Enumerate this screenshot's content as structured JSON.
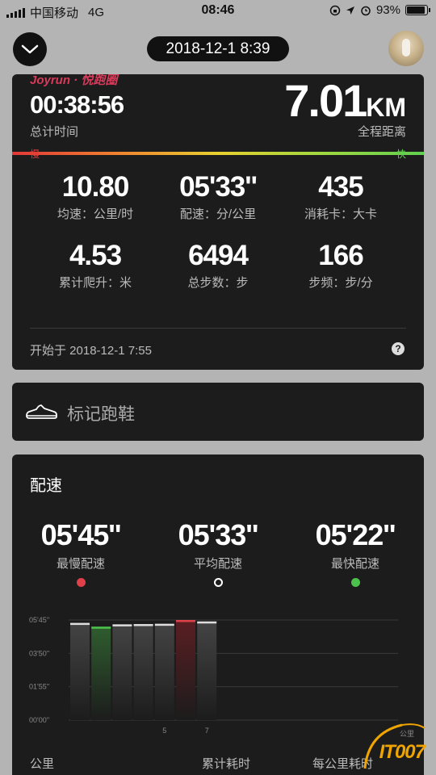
{
  "status_bar": {
    "carrier": "中国移动",
    "network": "4G",
    "time": "08:46",
    "battery": "93%"
  },
  "header": {
    "date": "2018-12-1 8:39"
  },
  "summary": {
    "brand": "Joyrun · 悦跑圈",
    "duration": "00:38:56",
    "duration_label": "总计时间",
    "distance": "7.01",
    "distance_unit": "KM",
    "distance_label": "全程距离",
    "slow_label": "慢",
    "fast_label": "快",
    "stats": [
      {
        "value": "10.80",
        "label": "均速：公里/时"
      },
      {
        "value": "05'33''",
        "label": "配速：分/公里"
      },
      {
        "value": "435",
        "label": "消耗卡：大卡"
      },
      {
        "value": "4.53",
        "label": "累计爬升：米"
      },
      {
        "value": "6494",
        "label": "总步数：步"
      },
      {
        "value": "166",
        "label": "步频：步/分"
      }
    ],
    "start_time": "开始于 2018-12-1 7:55",
    "help": "?"
  },
  "shoe": {
    "label": "标记跑鞋"
  },
  "pace": {
    "title": "配速",
    "slowest": {
      "value": "05'45''",
      "label": "最慢配速",
      "color": "#e0404a"
    },
    "average": {
      "value": "05'33''",
      "label": "平均配速",
      "color": "#ffffff"
    },
    "fastest": {
      "value": "05'22''",
      "label": "最快配速",
      "color": "#4cc24c"
    },
    "columns": [
      "公里",
      "累计耗时",
      "每公里耗时"
    ]
  },
  "chart_data": {
    "type": "bar",
    "categories": [
      "1",
      "2",
      "3",
      "4",
      "5",
      "6",
      "7"
    ],
    "x_tick_labels": [
      "5",
      "7"
    ],
    "x_unit": "公里",
    "y_tick_labels": [
      "05'45''",
      "03'50''",
      "01'55''",
      "00'00''"
    ],
    "ylim": [
      0,
      345
    ],
    "values": [
      335,
      322,
      330,
      331,
      332,
      345,
      340
    ],
    "value_units": "seconds per km",
    "highlight": {
      "fastest_index": 1,
      "slowest_index": 5
    },
    "colors": {
      "normal": "#444444",
      "fastest": "#2f5d2f",
      "slowest": "#5a1e22",
      "normal_cap": "#dddddd",
      "fastest_cap": "#4cc24c",
      "slowest_cap": "#e0404a"
    }
  },
  "watermark": {
    "text": "IT007"
  }
}
